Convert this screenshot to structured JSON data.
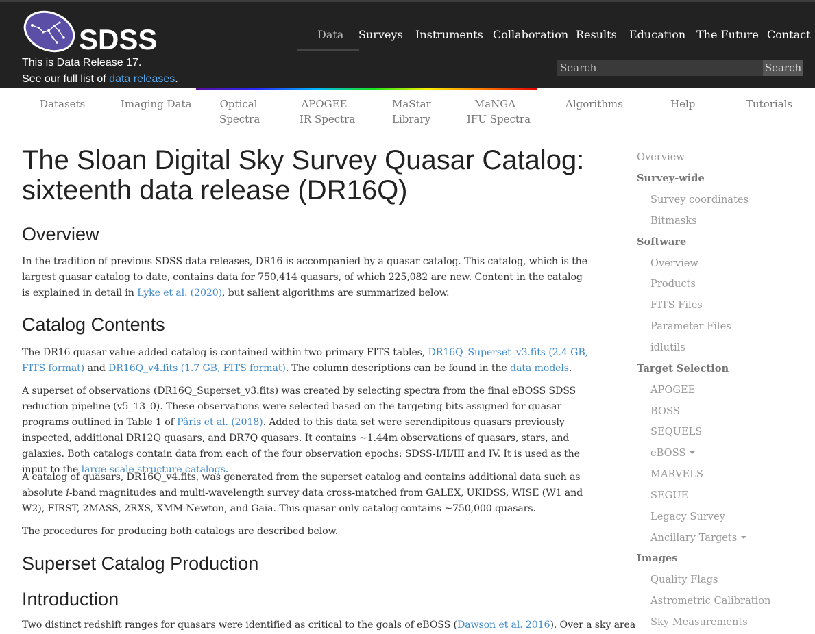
{
  "header": {
    "logo_text": "SDSS",
    "release_line1": "This is Data Release 17.",
    "release_line2_prefix": "See our full list of ",
    "release_line2_link": "data releases",
    "release_line2_suffix": ".",
    "nav": [
      "Data",
      "Surveys",
      "Instruments",
      "Collaboration",
      "Results",
      "Education",
      "The Future",
      "Contact"
    ],
    "active_nav": "Data",
    "search_placeholder": "Search",
    "search_button": "Search"
  },
  "subnav": [
    {
      "line1": "Datasets",
      "line2": ""
    },
    {
      "line1": "Imaging Data",
      "line2": ""
    },
    {
      "line1": "Optical",
      "line2": "Spectra"
    },
    {
      "line1": "APOGEE",
      "line2": "IR Spectra"
    },
    {
      "line1": "MaStar",
      "line2": "Library"
    },
    {
      "line1": "MaNGA",
      "line2": "IFU Spectra"
    },
    {
      "line1": "Algorithms",
      "line2": ""
    },
    {
      "line1": "Help",
      "line2": ""
    },
    {
      "line1": "Tutorials",
      "line2": ""
    }
  ],
  "main": {
    "title_line1": "The Sloan Digital Sky Survey Quasar Catalog:",
    "title_line2": "sixteenth data release (DR16Q)",
    "overview_heading": "Overview",
    "overview_p": {
      "t1": "In the tradition of previous SDSS data releases, DR16 is accompanied by a quasar catalog. This catalog, which is the largest quasar catalog to date, contains data for 750,414 quasars, of which 225,082 are new. Content in the catalog is explained in detail in ",
      "link1": "Lyke et al. (2020)",
      "t2": ", but salient algorithms are summarized below."
    },
    "contents_heading": "Catalog Contents",
    "contents_p1": {
      "t1": "The DR16 quasar value-added catalog is contained within two primary FITS tables, ",
      "link1": "DR16Q_Superset_v3.fits (2.4 GB, FITS format)",
      "t2": " and ",
      "link2": "DR16Q_v4.fits (1.7 GB, FITS format)",
      "t3": ". The column descriptions can be found in the ",
      "link3": "data models",
      "t4": "."
    },
    "contents_p2": {
      "t1": "A superset of observations (DR16Q_Superset_v3.fits) was created by selecting spectra from the final eBOSS SDSS reduction pipeline (v5_13_0). These observations were selected based on the targeting bits assigned for quasar programs outlined in Table 1 of ",
      "link1": "Pâris et al. (2018)",
      "t2": ". Added to this data set were serendipitous quasars previously inspected, additional DR12Q quasars, and DR7Q quasars. It contains ~1.44m observations of quasars, stars, and galaxies. Both catalogs contain data from each of the four observation epochs: SDSS-I/II/III and IV. It is used as the input to the ",
      "link2": "large-scale structure catalogs",
      "t3": "."
    },
    "contents_p3": {
      "t1": "A catalog of quasars, DR16Q_v4.fits, was generated from the superset catalog and contains additional data such as absolute ",
      "italic": "i",
      "t2": "-band magnitudes and multi-wavelength survey data cross-matched from GALEX, UKIDSS, WISE (W1 and W2), FIRST, 2MASS, 2RXS, XMM-Newton, and Gaia. This quasar-only catalog contains ~750,000 quasars."
    },
    "contents_p4": "The procedures for producing both catalogs are described below.",
    "superset_heading": "Superset Catalog Production",
    "intro_heading": "Introduction",
    "intro_p": {
      "t1": "Two distinct redshift ranges for quasars were identified as critical to the goals of eBOSS (",
      "link1": "Dawson et al. 2016",
      "t2": "). Over a sky area"
    }
  },
  "sidebar": {
    "overview": "Overview",
    "survey_wide": "Survey-wide",
    "survey_coordinates": "Survey coordinates",
    "bitmasks": "Bitmasks",
    "software": "Software",
    "sw_overview": "Overview",
    "products": "Products",
    "fits_files": "FITS Files",
    "parameter_files": "Parameter Files",
    "idlutils": "idlutils",
    "target_selection": "Target Selection",
    "apogee": "APOGEE",
    "boss": "BOSS",
    "sequels": "SEQUELS",
    "eboss": "eBOSS",
    "marvels": "MARVELS",
    "segue": "SEGUE",
    "legacy_survey": "Legacy Survey",
    "ancillary_targets": "Ancillary Targets",
    "images": "Images",
    "quality_flags": "Quality Flags",
    "astrometric_calibration": "Astrometric Calibration",
    "sky_measurements": "Sky Measurements"
  },
  "colors": {
    "header_bg": "#222222",
    "link": "#428bca",
    "header_link": "#58aaf0",
    "logo_purple": "#5b4ea6"
  }
}
